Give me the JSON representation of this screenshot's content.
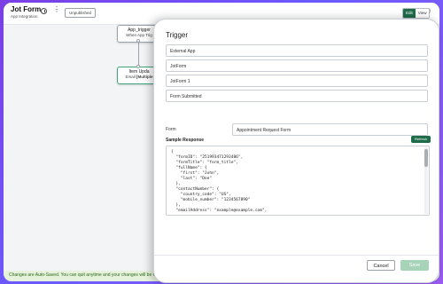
{
  "header": {
    "title": "Jot Form",
    "subtitle": "App Integration",
    "status_badge": "Unpublished",
    "edit_label": "Edit",
    "view_label": "View"
  },
  "canvas": {
    "nodes": [
      {
        "title": "App_trigger",
        "subtitle": "When App Trig"
      },
      {
        "title": "Item Upda",
        "subtitle_prefix": "Email ",
        "subtitle_bold": "[Multiple"
      }
    ]
  },
  "statusbar": {
    "text": "Changes are Auto-Saved. You can quit anytime and your changes will be retained."
  },
  "trigger_panel": {
    "title": "Trigger",
    "fields": [
      {
        "value": "External App"
      },
      {
        "value": "JotForm"
      },
      {
        "value": "JotForm 1"
      },
      {
        "value": "Form Submitted"
      }
    ],
    "form_label": "Form",
    "form_value": "Appointment Request Form",
    "sample_response_label": "Sample Response",
    "refresh_label": "Refresh",
    "code_lines": [
      "{",
      "  \"formID\": \"251993471293486\",",
      "  \"formTitle\": \"form_title\",",
      "  \"fullName\": {",
      "    \"first\": \"John\",",
      "    \"last\": \"Doe\"",
      "  },",
      "  \"contactNumber\": {",
      "    \"country_code\": \"US\",",
      "    \"mobile_number\": \"1234567890\"",
      "  },",
      "  \"emailAddress\": \"example@example.com\","
    ],
    "cancel_label": "Cancel",
    "save_label": "Save"
  },
  "colors": {
    "accent_green": "#1f6b4a",
    "save_disabled": "#a7d3b9",
    "statusbar_bg": "#e6f2dc",
    "background_gradient": "#7b3fe4"
  }
}
